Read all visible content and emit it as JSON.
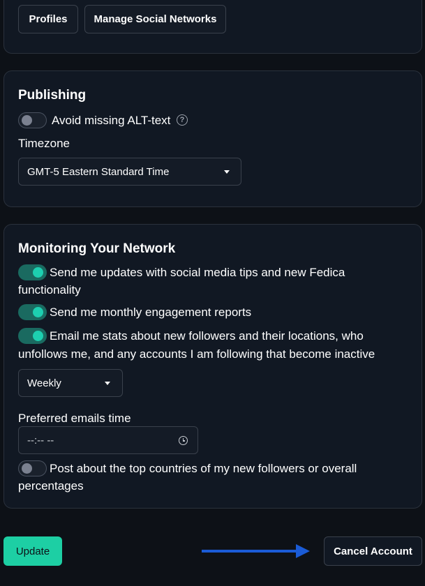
{
  "top_card": {
    "profiles_label": "Profiles",
    "manage_label": "Manage Social Networks"
  },
  "publishing": {
    "title": "Publishing",
    "alt_text_label": "Avoid missing ALT-text",
    "alt_text_enabled": false,
    "help_glyph": "?",
    "timezone_label": "Timezone",
    "timezone_value": "GMT-5 Eastern Standard Time"
  },
  "monitoring": {
    "title": "Monitoring Your Network",
    "tips_line1": "Send me updates with social media tips and new Fedica",
    "tips_line2": "functionality",
    "tips_enabled": true,
    "reports_label": "Send me monthly engagement reports",
    "reports_enabled": true,
    "stats_line1": "Email me stats about new followers and their locations, who",
    "stats_line2": "unfollows me, and any accounts I am following that become inactive",
    "stats_enabled": true,
    "frequency_value": "Weekly",
    "email_time_label": "Preferred emails time",
    "email_time_value": "--:-- --",
    "countries_line1": "Post about the top countries of my new followers or overall",
    "countries_line2": "percentages",
    "countries_enabled": false
  },
  "footer": {
    "update_label": "Update",
    "cancel_label": "Cancel Account"
  },
  "colors": {
    "accent": "#1dcfa4",
    "annotation_arrow": "#1a5bd6",
    "background": "#0d1117"
  },
  "icons": {
    "help": "question-circle-icon",
    "caret": "caret-down-icon",
    "clock": "clock-icon",
    "arrow": "arrow-right-icon"
  }
}
